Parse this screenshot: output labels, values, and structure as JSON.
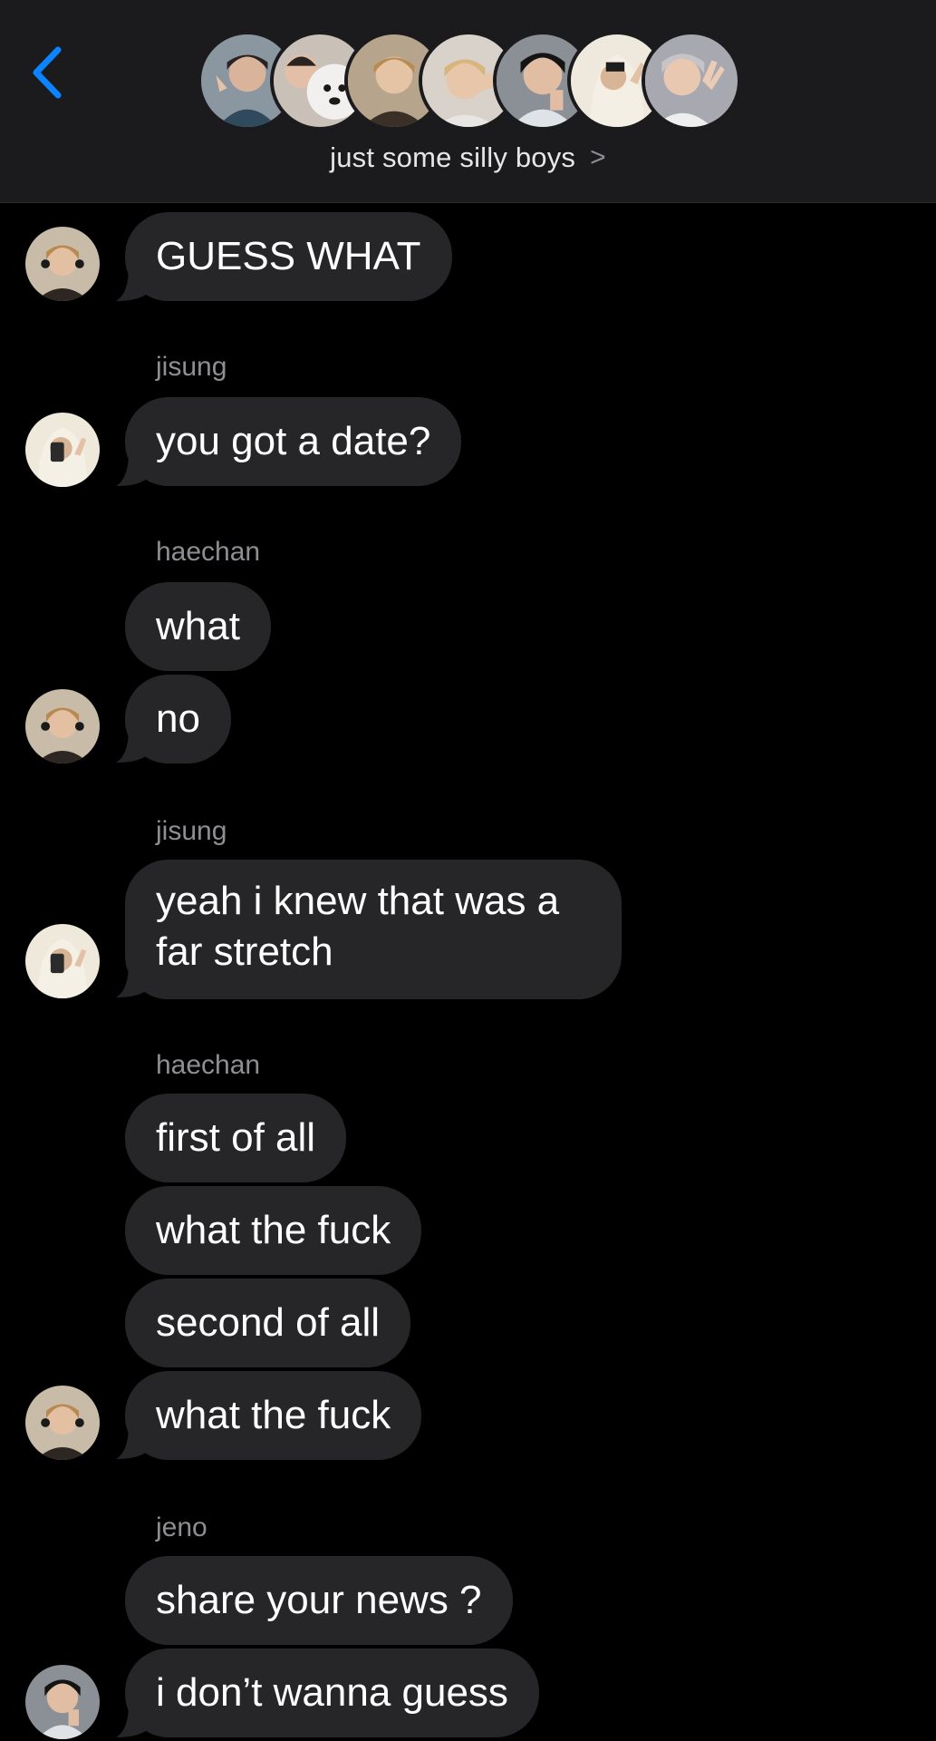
{
  "header": {
    "group_name": "just some silly boys",
    "chevron": ">"
  },
  "messages": [
    {
      "text": "GUESS WHAT"
    },
    {
      "sender": "jisung",
      "text": "you got a date?"
    },
    {
      "sender": "haechan",
      "text": "what"
    },
    {
      "text": "no"
    },
    {
      "sender": "jisung",
      "line1": "yeah i knew that was a",
      "line2": "far stretch"
    },
    {
      "sender": "haechan",
      "text": "first of all"
    },
    {
      "text": "what the fuck"
    },
    {
      "text": "second of all"
    },
    {
      "text": "what the fuck"
    },
    {
      "sender": "jeno",
      "text": "share your news ?"
    },
    {
      "text": "i don’t wanna guess"
    }
  ],
  "colors": {
    "background": "#000000",
    "header": "#1b1b1d",
    "bubble": "#262628",
    "accent": "#0a84ff",
    "sender_label": "#8e8e93"
  },
  "icons": {
    "back": "chevron-left-icon",
    "group_chevron": "chevron-right-icon"
  }
}
